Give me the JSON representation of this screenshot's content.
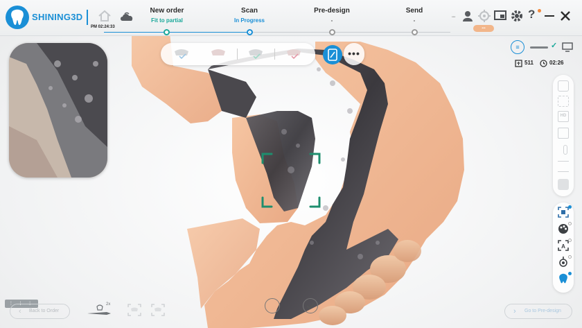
{
  "brand": "SHINING3D",
  "clock": "PM 02:24:33",
  "stages": [
    {
      "title": "New order",
      "sub": "Fit to partial",
      "sub_color": "#1aa89a",
      "state": "done"
    },
    {
      "title": "Scan",
      "sub": "In Progress",
      "sub_color": "#1a8fd6",
      "state": "active"
    },
    {
      "title": "Pre-design",
      "sub": "-",
      "sub_color": "#555555",
      "state": "pending"
    },
    {
      "title": "Send",
      "sub": "-",
      "sub_color": "#555555",
      "state": "pending"
    }
  ],
  "header_icons": [
    "user-icon",
    "target-icon",
    "screen-share-icon",
    "settings-icon",
    "help-icon",
    "minimize-icon",
    "close-icon"
  ],
  "scan_counter": "511",
  "scan_timer": "02:26",
  "back_label": "Back to Order",
  "go_label": "Go to Pre-design",
  "mini_bar": "⋮ ⋮ ⋮",
  "zoom_label": "2x",
  "colors": {
    "accent": "#1a8fd6",
    "teal": "#1aa89a",
    "frame": "#1e8e6e"
  }
}
